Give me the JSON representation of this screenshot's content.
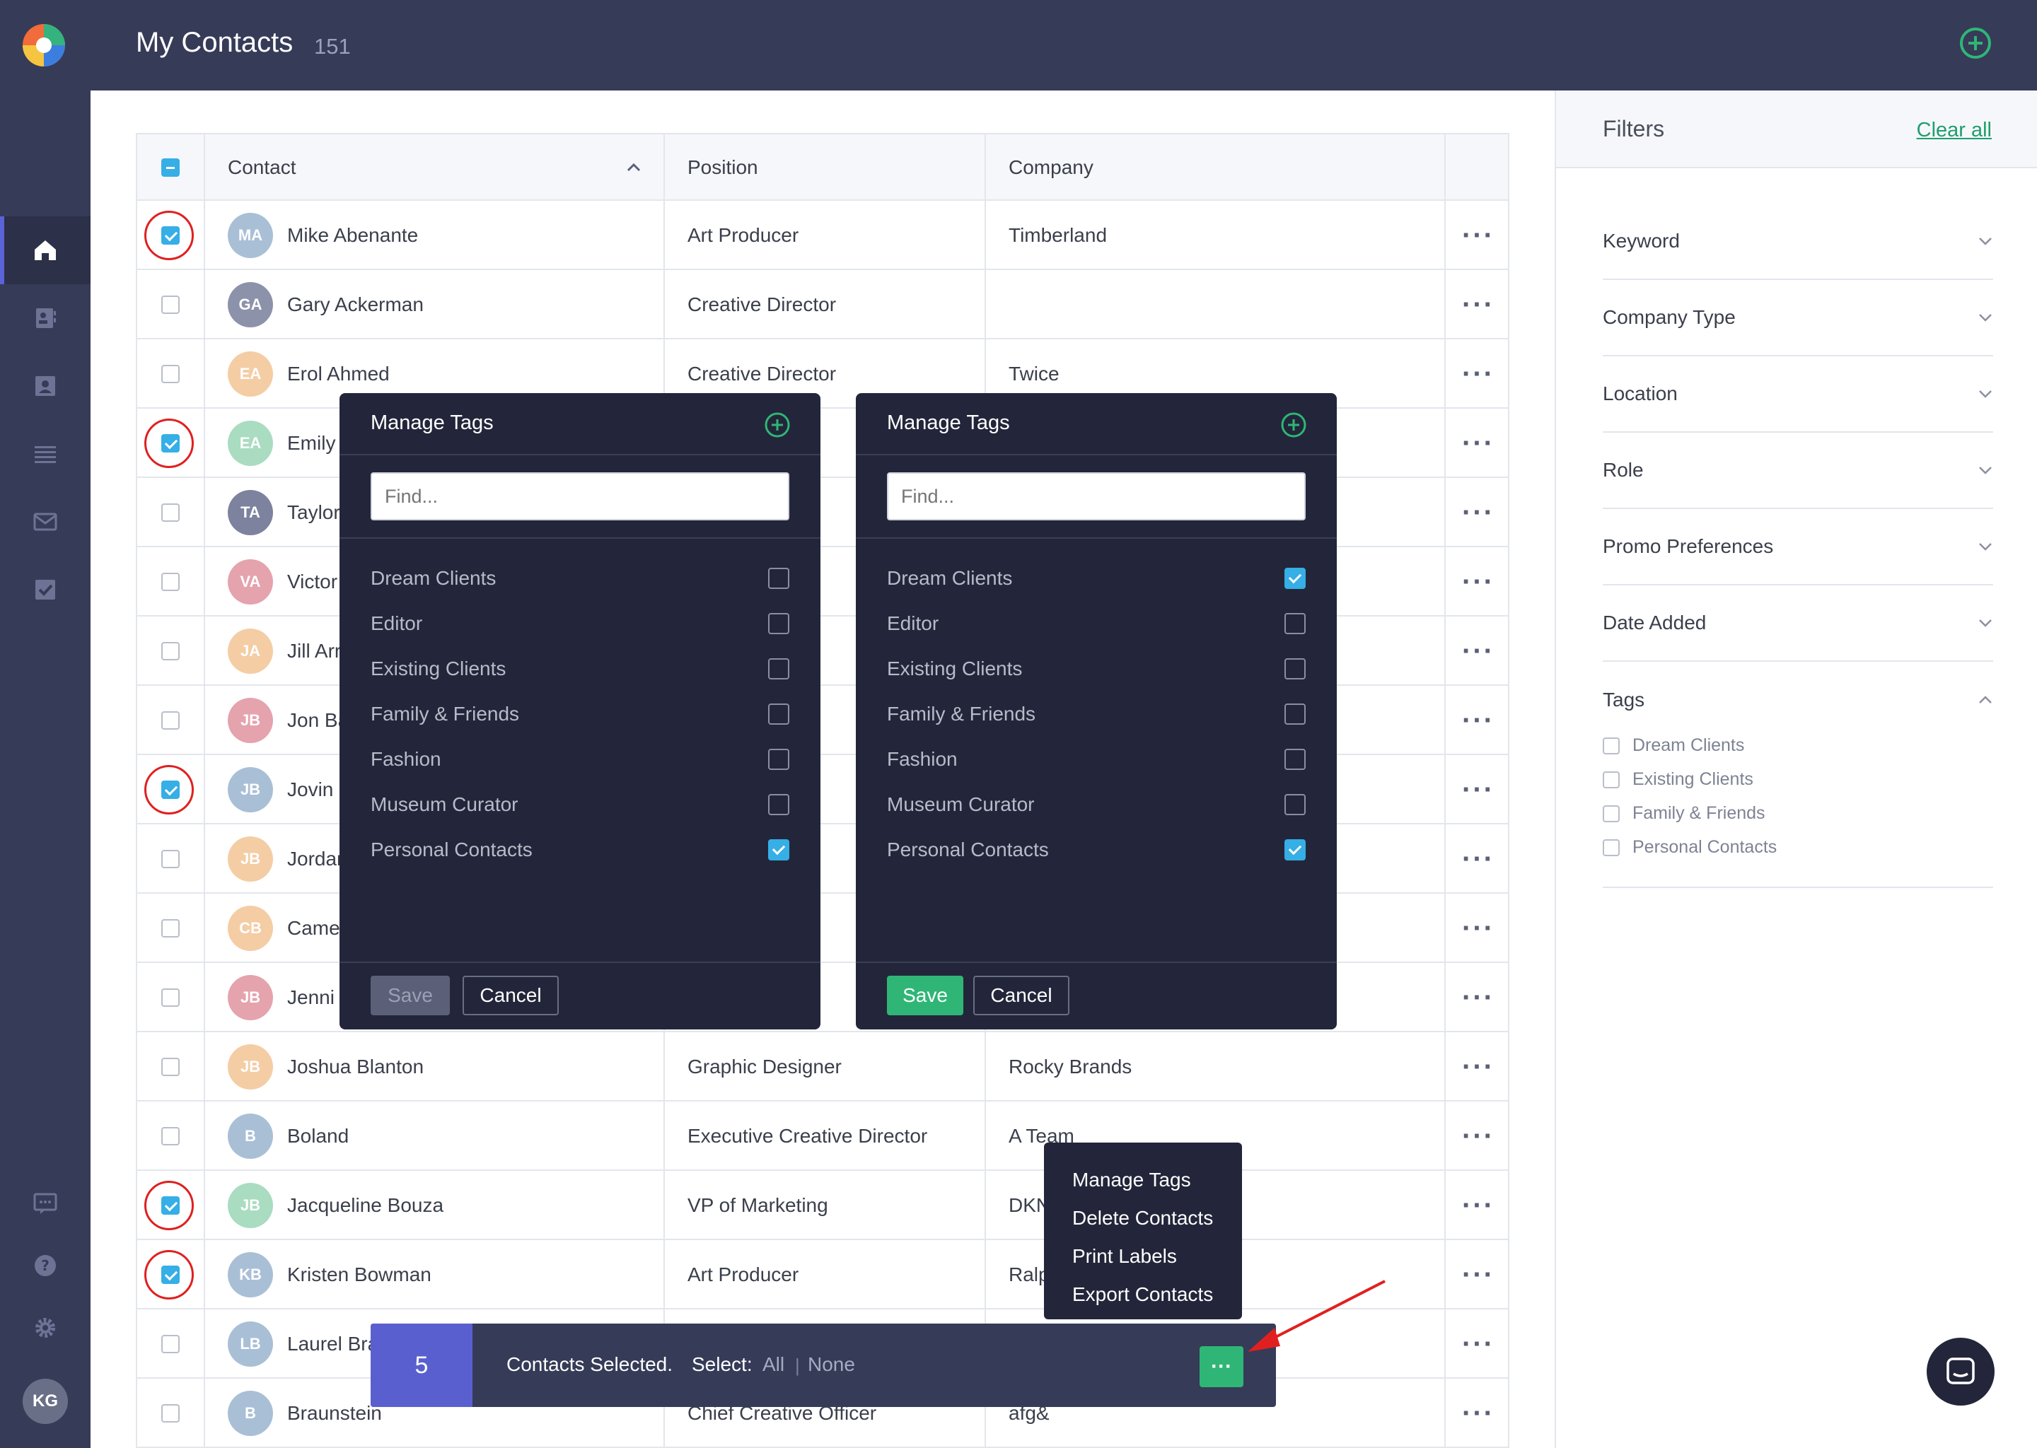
{
  "header": {
    "title": "My Contacts",
    "count": "151"
  },
  "user": {
    "initials": "KG"
  },
  "table": {
    "columns": {
      "contact": "Contact",
      "position": "Position",
      "company": "Company"
    },
    "rows": [
      {
        "initials": "MA",
        "name": "Mike Abenante",
        "position": "Art Producer",
        "company": "Timberland",
        "checked": true,
        "color": "#a9bfd6"
      },
      {
        "initials": "GA",
        "name": "Gary Ackerman",
        "position": "Creative Director",
        "company": "",
        "checked": false,
        "color": "#8d92ab"
      },
      {
        "initials": "EA",
        "name": "Erol Ahmed",
        "position": "Creative Director",
        "company": "Twice",
        "checked": false,
        "color": "#f4cda4"
      },
      {
        "initials": "EA",
        "name": "Emily",
        "position": "",
        "company": "",
        "checked": true,
        "color": "#a9dcc0"
      },
      {
        "initials": "TA",
        "name": "Taylor",
        "position": "",
        "company": "",
        "checked": false,
        "color": "#7d829e"
      },
      {
        "initials": "VA",
        "name": "Victor",
        "position": "Dire",
        "company": "",
        "checked": false,
        "color": "#e5a3ad"
      },
      {
        "initials": "JA",
        "name": "Jill Arr",
        "position": "r",
        "company": "",
        "checked": false,
        "color": "#f4cda4"
      },
      {
        "initials": "JB",
        "name": "Jon Ba",
        "position": "or",
        "company": "",
        "checked": false,
        "color": "#e5a3ad"
      },
      {
        "initials": "JB",
        "name": "Jovin E",
        "position": "",
        "company": "",
        "checked": true,
        "color": "#a9bfd6"
      },
      {
        "initials": "JB",
        "name": "Jordan",
        "position": "",
        "company": "",
        "checked": false,
        "color": "#f4cda4"
      },
      {
        "initials": "CB",
        "name": "Camer",
        "position": "",
        "company": "",
        "checked": false,
        "color": "#f4cda4"
      },
      {
        "initials": "JB",
        "name": "Jenni E",
        "position": "",
        "company": "",
        "checked": false,
        "color": "#e5a3ad"
      },
      {
        "initials": "JB",
        "name": "Joshua Blanton",
        "position": "Graphic Designer",
        "company": "Rocky Brands",
        "checked": false,
        "color": "#f4cda4"
      },
      {
        "initials": "B",
        "name": "Boland",
        "position": "Executive Creative Director",
        "company": "A Team",
        "checked": false,
        "color": "#a9bfd6"
      },
      {
        "initials": "JB",
        "name": "Jacqueline Bouza",
        "position": "VP of Marketing",
        "company": "DKNY",
        "checked": true,
        "color": "#a9dcc0"
      },
      {
        "initials": "KB",
        "name": "Kristen Bowman",
        "position": "Art Producer",
        "company": "Ralph",
        "checked": true,
        "color": "#a9bfd6"
      },
      {
        "initials": "LB",
        "name": "Laurel Bra",
        "position": "",
        "company": "",
        "checked": false,
        "color": "#a9bfd6"
      },
      {
        "initials": "B",
        "name": "Braunstein",
        "position": "Chief Creative Officer",
        "company": "afg&",
        "checked": false,
        "color": "#a9bfd6"
      }
    ]
  },
  "filters": {
    "title": "Filters",
    "clear_all": "Clear all",
    "sections": [
      "Keyword",
      "Company Type",
      "Location",
      "Role",
      "Promo Preferences",
      "Date Added",
      "Tags"
    ],
    "tag_options": [
      "Dream Clients",
      "Existing Clients",
      "Family & Friends",
      "Personal Contacts"
    ]
  },
  "manage_tags_left": {
    "title": "Manage Tags",
    "find_placeholder": "Find...",
    "items": [
      {
        "label": "Dream Clients",
        "checked": false
      },
      {
        "label": "Editor",
        "checked": false
      },
      {
        "label": "Existing Clients",
        "checked": false
      },
      {
        "label": "Family & Friends",
        "checked": false
      },
      {
        "label": "Fashion",
        "checked": false
      },
      {
        "label": "Museum Curator",
        "checked": false
      },
      {
        "label": "Personal Contacts",
        "checked": true
      }
    ],
    "save": "Save",
    "cancel": "Cancel"
  },
  "manage_tags_right": {
    "title": "Manage Tags",
    "find_placeholder": "Find...",
    "items": [
      {
        "label": "Dream Clients",
        "checked": true
      },
      {
        "label": "Editor",
        "checked": false
      },
      {
        "label": "Existing Clients",
        "checked": false
      },
      {
        "label": "Family & Friends",
        "checked": false
      },
      {
        "label": "Fashion",
        "checked": false
      },
      {
        "label": "Museum Curator",
        "checked": false
      },
      {
        "label": "Personal Contacts",
        "checked": true
      }
    ],
    "save": "Save",
    "cancel": "Cancel"
  },
  "menu": {
    "items": [
      "Manage Tags",
      "Delete Contacts",
      "Print Labels",
      "Export Contacts"
    ]
  },
  "selection": {
    "count": "5",
    "text": "Contacts Selected.",
    "select_label": "Select:",
    "all": "All",
    "divider": "|",
    "none": "None",
    "more": "···"
  },
  "colors": {
    "accent_green": "#2fb676",
    "checkbox_blue": "#36aee6",
    "nav_bg": "#363b58",
    "popup_bg": "#23263a"
  }
}
